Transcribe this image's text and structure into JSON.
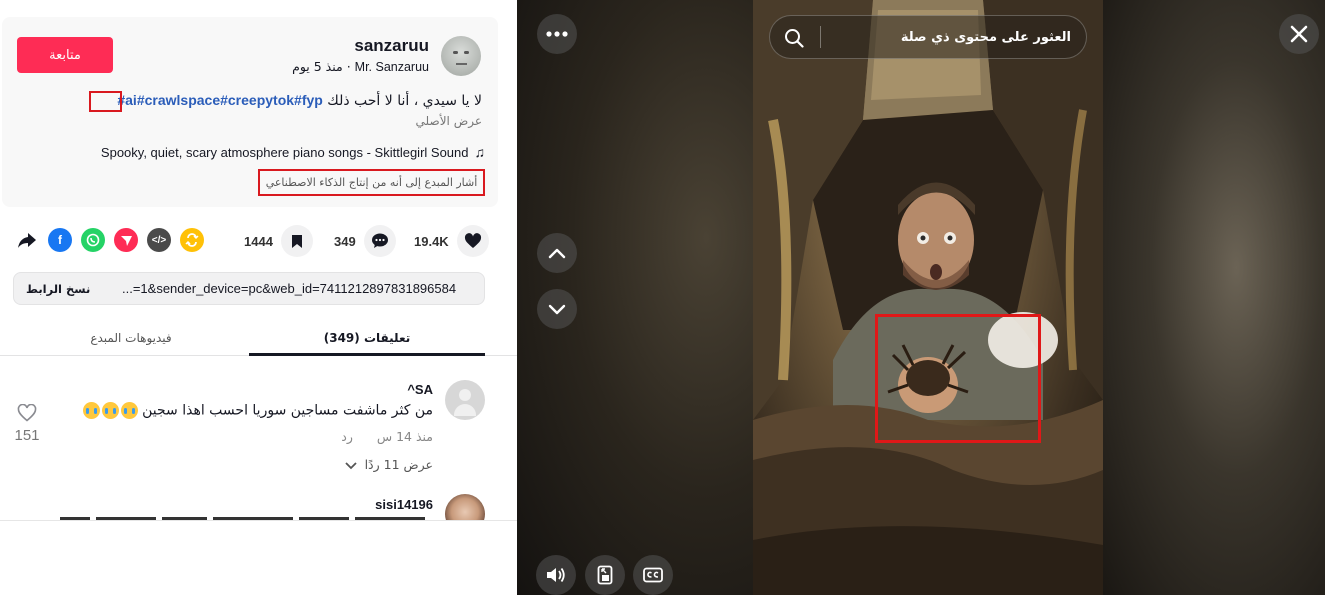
{
  "author": {
    "username": "sanzaruu",
    "nickname": "Mr. Sanzaruu",
    "posted": "منذ 5 يوم",
    "follow_label": "متابعة"
  },
  "post": {
    "caption_text": "لا يا سيدي ، أنا لا أحب ذلك",
    "hashtags": "#ai#crawlspace#creepytok#fyp",
    "see_original": "عرض الأصلي",
    "music": "Spooky, quiet, scary atmosphere piano songs - Skittlegirl Sound",
    "ai_label": "أشار المبدع إلى أنه من إنتاج الذكاء الاصطناعي"
  },
  "stats": {
    "likes": "19.4K",
    "comments": "349",
    "saves": "1444"
  },
  "share_icons": [
    "arrow-share-icon",
    "facebook-icon",
    "whatsapp-icon",
    "send-icon",
    "embed-icon",
    "repost-icon"
  ],
  "colors": {
    "accent": "#fe2c55",
    "hashtag": "#2b5db9",
    "highlight": "#d9191f",
    "facebook": "#1877f2",
    "whatsapp": "#25d366",
    "send": "#fe2c55",
    "embed": "#4a4a4a",
    "repost": "#ffc107"
  },
  "link": {
    "url": "...=1&sender_device=pc&web_id=7411212897831896584",
    "copy_label": "نسخ الرابط"
  },
  "tabs": {
    "comments": "(349) تعليقات",
    "creator_videos": "فيديوهات المبدع"
  },
  "comments": [
    {
      "user": "^SA",
      "text": "من كثر ماشفت مساجين سوريا احسب اهذا سجين",
      "time": "منذ 14 س",
      "reply": "رد",
      "likes": "151",
      "view_replies": "عرض 11 ردًا"
    },
    {
      "user": "sisi14196"
    }
  ],
  "video": {
    "search_placeholder": "العثور على محتوى ذي صلة"
  }
}
